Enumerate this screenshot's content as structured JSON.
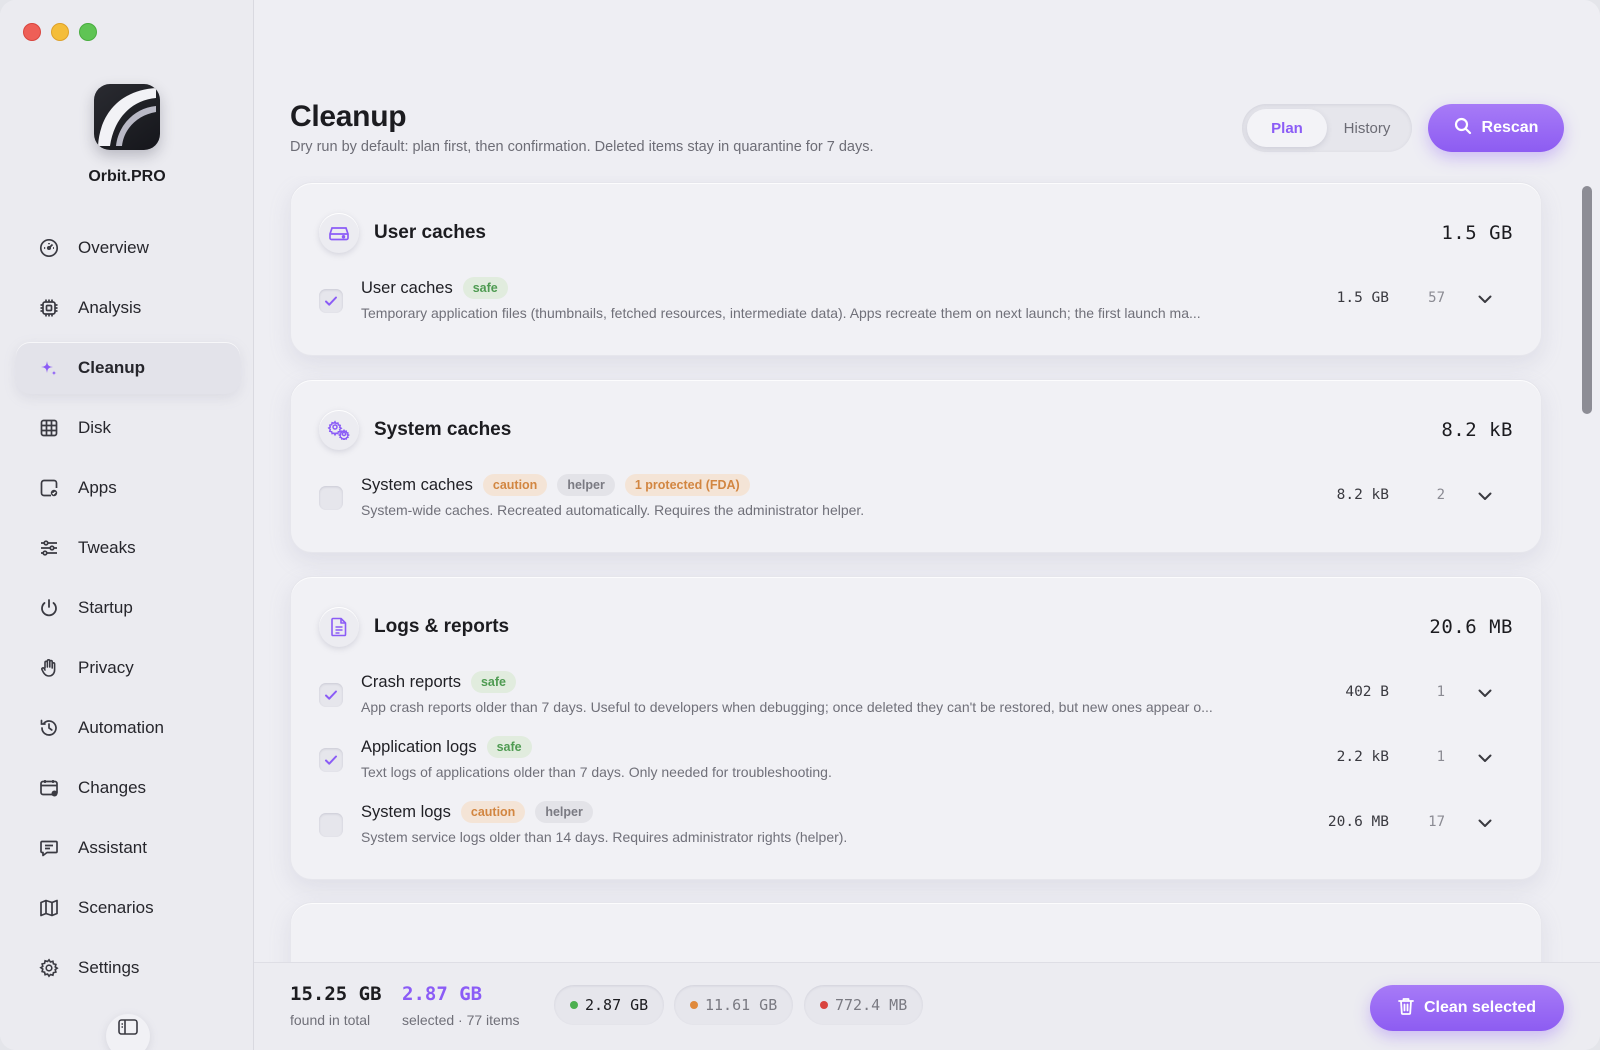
{
  "app": {
    "name": "Orbit.PRO"
  },
  "sidebar": {
    "items": [
      {
        "label": "Overview",
        "icon": "gauge-icon"
      },
      {
        "label": "Analysis",
        "icon": "chip-icon"
      },
      {
        "label": "Cleanup",
        "icon": "sparkle-icon",
        "active": true
      },
      {
        "label": "Disk",
        "icon": "grid-icon"
      },
      {
        "label": "Apps",
        "icon": "app-check-icon"
      },
      {
        "label": "Tweaks",
        "icon": "sliders-icon"
      },
      {
        "label": "Startup",
        "icon": "power-icon"
      },
      {
        "label": "Privacy",
        "icon": "hand-icon"
      },
      {
        "label": "Automation",
        "icon": "history-icon"
      },
      {
        "label": "Changes",
        "icon": "calendar-icon"
      },
      {
        "label": "Assistant",
        "icon": "chat-icon"
      },
      {
        "label": "Scenarios",
        "icon": "map-icon"
      },
      {
        "label": "Settings",
        "icon": "gear-icon"
      }
    ]
  },
  "header": {
    "title": "Cleanup",
    "subtitle": "Dry run by default: plan first, then confirmation. Deleted items stay in quarantine for 7 days.",
    "tabs": [
      {
        "label": "Plan",
        "active": true
      },
      {
        "label": "History",
        "active": false
      }
    ],
    "rescan_label": "Rescan"
  },
  "groups": [
    {
      "title": "User caches",
      "size": "1.5 GB",
      "icon": "drive-icon",
      "rows": [
        {
          "name": "User caches",
          "checked": true,
          "badges": [
            {
              "text": "safe",
              "kind": "safe"
            }
          ],
          "desc": "Temporary application files (thumbnails, fetched resources, intermediate data). Apps recreate them on next launch; the first launch ma...",
          "size": "1.5 GB",
          "count": "57"
        }
      ]
    },
    {
      "title": "System caches",
      "size": "8.2 kB",
      "icon": "gears-icon",
      "rows": [
        {
          "name": "System caches",
          "checked": false,
          "badges": [
            {
              "text": "caution",
              "kind": "caution"
            },
            {
              "text": "helper",
              "kind": "helper"
            },
            {
              "text": "1 protected (FDA)",
              "kind": "protected"
            }
          ],
          "desc": "System-wide caches. Recreated automatically. Requires the administrator helper.",
          "size": "8.2 kB",
          "count": "2"
        }
      ]
    },
    {
      "title": "Logs & reports",
      "size": "20.6 MB",
      "icon": "document-icon",
      "rows": [
        {
          "name": "Crash reports",
          "checked": true,
          "badges": [
            {
              "text": "safe",
              "kind": "safe"
            }
          ],
          "desc": "App crash reports older than 7 days. Useful to developers when debugging; once deleted they can't be restored, but new ones appear o...",
          "size": "402 B",
          "count": "1"
        },
        {
          "name": "Application logs",
          "checked": true,
          "badges": [
            {
              "text": "safe",
              "kind": "safe"
            }
          ],
          "desc": "Text logs of applications older than 7 days. Only needed for troubleshooting.",
          "size": "2.2 kB",
          "count": "1"
        },
        {
          "name": "System logs",
          "checked": false,
          "badges": [
            {
              "text": "caution",
              "kind": "caution"
            },
            {
              "text": "helper",
              "kind": "helper"
            }
          ],
          "desc": "System service logs older than 14 days. Requires administrator rights (helper).",
          "size": "20.6 MB",
          "count": "17"
        }
      ]
    }
  ],
  "footer": {
    "total_value": "15.25 GB",
    "total_label": "found in total",
    "selected_value": "2.87 GB",
    "selected_label": "selected · 77 items",
    "pills": [
      {
        "value": "2.87 GB",
        "color": "#4caf50"
      },
      {
        "value": "11.61 GB",
        "color": "#e08a3c"
      },
      {
        "value": "772.4 MB",
        "color": "#d9443f"
      }
    ],
    "clean_label": "Clean selected"
  },
  "colors": {
    "accent": "#8b5cf6"
  }
}
